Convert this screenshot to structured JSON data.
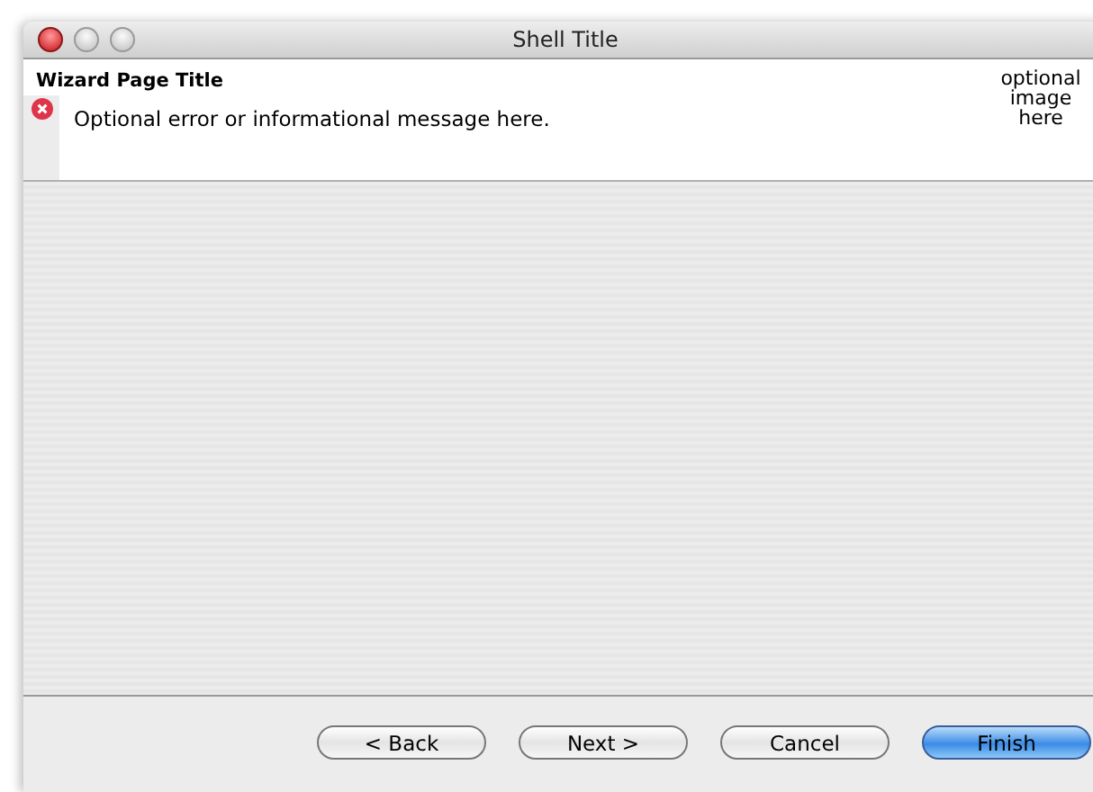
{
  "window": {
    "title": "Shell Title"
  },
  "header": {
    "title": "Wizard Page Title",
    "message": "Optional error or informational message here.",
    "error": true,
    "image_text": "optional image here"
  },
  "buttons": [
    {
      "label": "< Back",
      "default": false
    },
    {
      "label": "Next >",
      "default": false
    },
    {
      "label": "Cancel",
      "default": false
    },
    {
      "label": "Finish",
      "default": true
    }
  ]
}
